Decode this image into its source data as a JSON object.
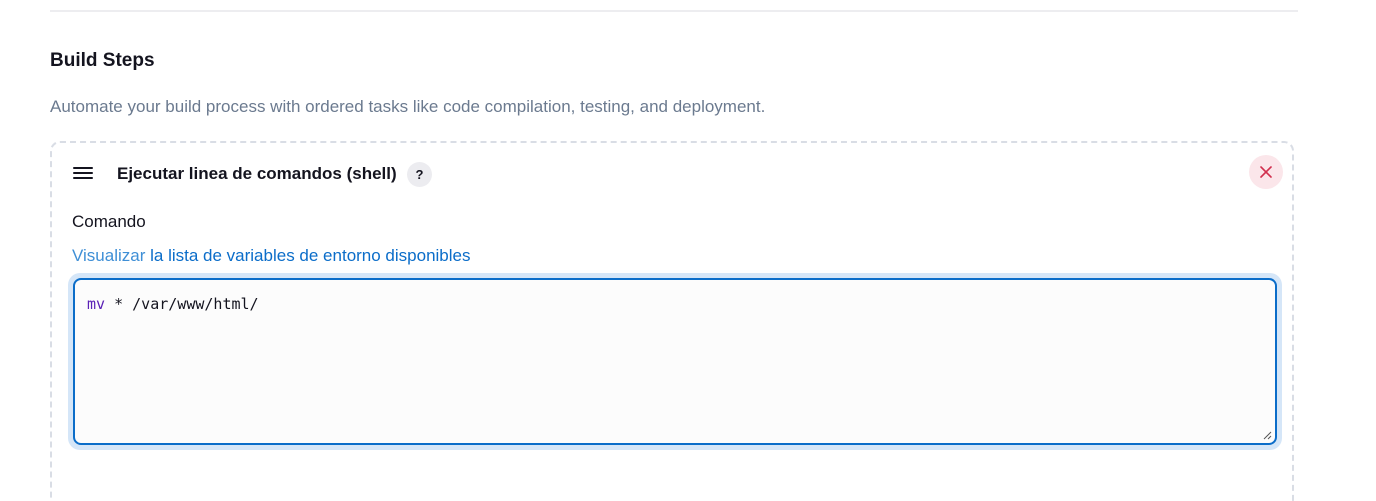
{
  "section": {
    "title": "Build Steps",
    "description": "Automate your build process with ordered tasks like code compilation, testing, and deployment."
  },
  "step": {
    "title": "Ejecutar linea de comandos (shell)",
    "help_label": "?",
    "field_label": "Comando",
    "env_prefix": "Visualizar",
    "env_link": "la lista de variables de entorno disponibles",
    "command_keyword": "mv",
    "command_rest": " * /var/www/html/"
  },
  "icons": {
    "drag": "drag-handle-icon",
    "close": "close-icon",
    "help": "question-mark-icon",
    "resize": "resize-grip-icon"
  },
  "colors": {
    "accent": "#0b6dc9",
    "close_bg": "#fbe6ea",
    "close_fg": "#d1304e",
    "muted_text": "#6b7a8f"
  }
}
